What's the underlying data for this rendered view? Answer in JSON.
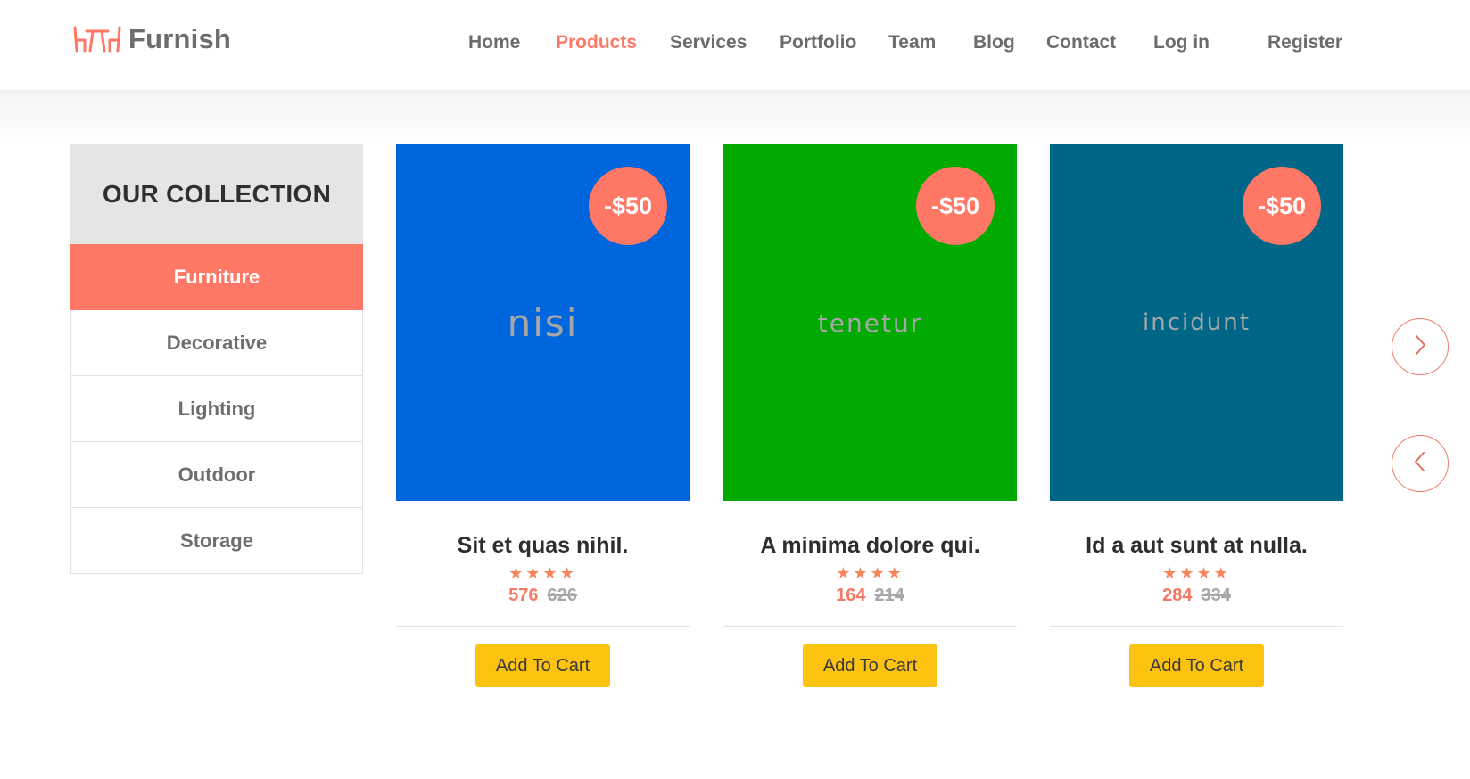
{
  "header": {
    "logo_text": "Furnish",
    "nav": [
      {
        "label": "Home",
        "active": false
      },
      {
        "label": "Products",
        "active": true
      },
      {
        "label": "Services",
        "active": false
      },
      {
        "label": "Portfolio",
        "active": false
      },
      {
        "label": "Team",
        "active": false
      },
      {
        "label": "Blog",
        "active": false
      },
      {
        "label": "Contact",
        "active": false
      },
      {
        "label": "Log in",
        "active": false
      },
      {
        "label": "Register",
        "active": false
      }
    ]
  },
  "sidebar": {
    "title": "OUR COLLECTION",
    "categories": [
      {
        "label": "Furniture",
        "active": true
      },
      {
        "label": "Decorative",
        "active": false
      },
      {
        "label": "Lighting",
        "active": false
      },
      {
        "label": "Outdoor",
        "active": false
      },
      {
        "label": "Storage",
        "active": false
      }
    ]
  },
  "products": [
    {
      "image_text": "nisi",
      "image_color": "#0066dd",
      "badge": "-$50",
      "title": "Sit et quas nihil.",
      "rating": 4,
      "stars": "★★★★",
      "price": "576",
      "old_price": "626",
      "cta": "Add To Cart"
    },
    {
      "image_text": "tenetur",
      "image_color": "#00aa00",
      "badge": "-$50",
      "title": "A minima dolore qui.",
      "rating": 4,
      "stars": "★★★★",
      "price": "164",
      "old_price": "214",
      "cta": "Add To Cart"
    },
    {
      "image_text": "incidunt",
      "image_color": "#006688",
      "badge": "-$50",
      "title": "Id a aut sunt at nulla.",
      "rating": 4,
      "stars": "★★★★",
      "price": "284",
      "old_price": "334",
      "cta": "Add To Cart"
    }
  ],
  "colors": {
    "accent": "#fe7865",
    "button": "#fcc210",
    "sidebar_header": "#e5e5e5"
  },
  "icons": {
    "logo": "table-chairs-icon",
    "next": "chevron-right-icon",
    "prev": "chevron-left-icon"
  }
}
